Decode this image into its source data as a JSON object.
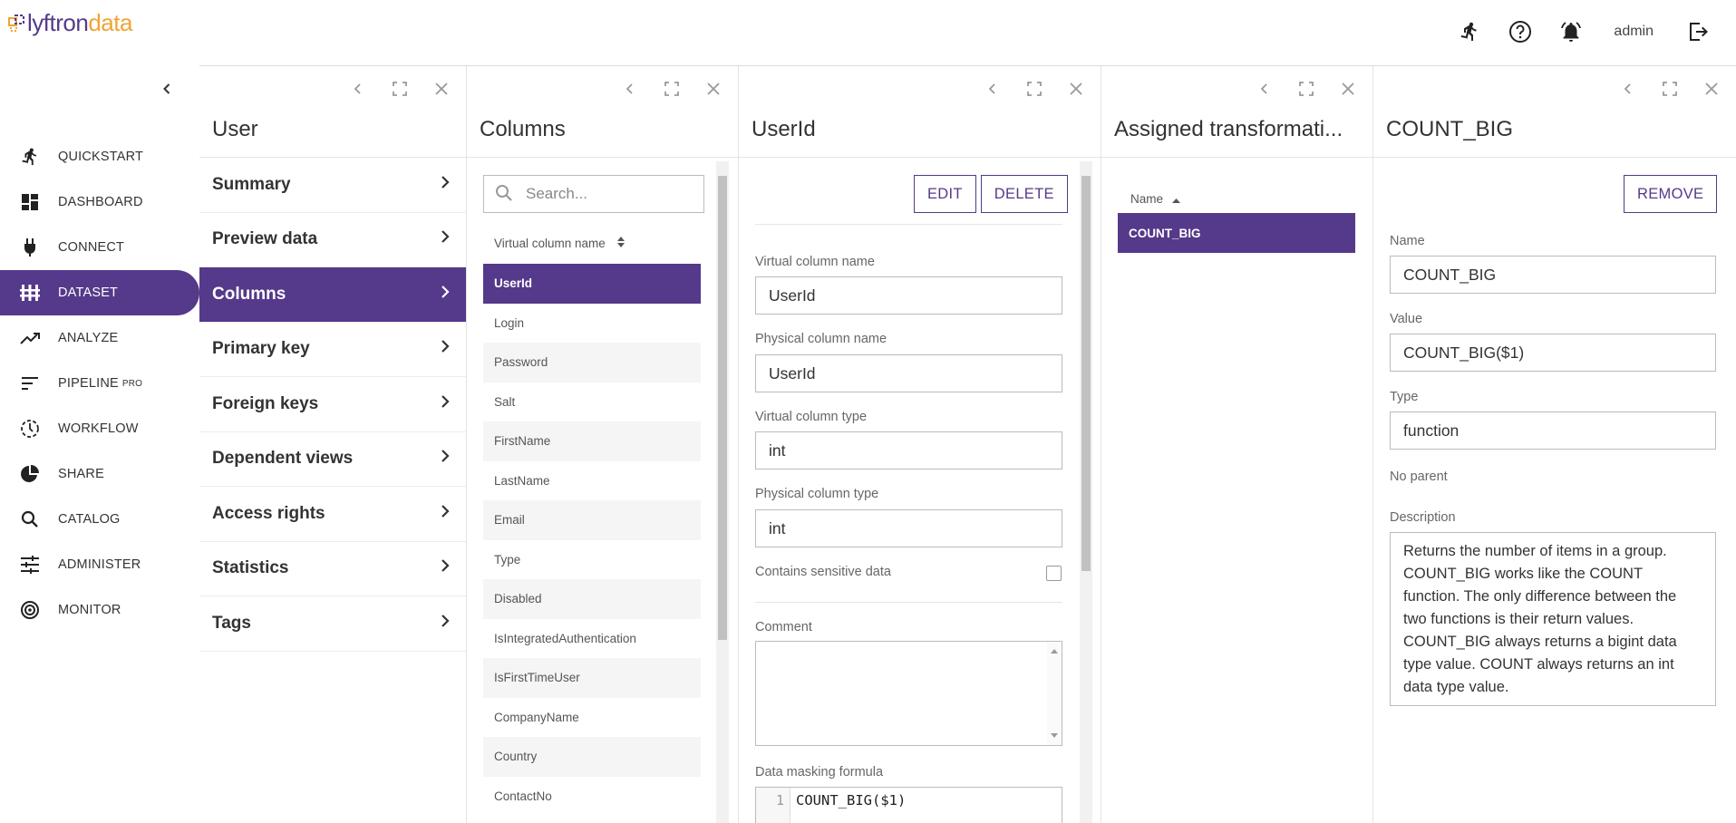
{
  "brand": {
    "logo_part1": "lyftron",
    "logo_part2": "data"
  },
  "header": {
    "user": "admin",
    "icons": [
      "quickstart-runner-icon",
      "help-icon",
      "notifications-bell-icon",
      "logout-icon"
    ]
  },
  "sidebar": {
    "items": [
      {
        "label": "QUICKSTART",
        "icon": "runner-icon"
      },
      {
        "label": "DASHBOARD",
        "icon": "dashboard-icon"
      },
      {
        "label": "CONNECT",
        "icon": "plug-icon"
      },
      {
        "label": "DATASET",
        "icon": "dataset-icon",
        "active": true
      },
      {
        "label": "ANALYZE",
        "icon": "trending-up-icon"
      },
      {
        "label": "PIPELINE",
        "badge": "PRO",
        "icon": "pipeline-icon"
      },
      {
        "label": "WORKFLOW",
        "icon": "workflow-icon"
      },
      {
        "label": "SHARE",
        "icon": "pie-chart-icon"
      },
      {
        "label": "CATALOG",
        "icon": "search-icon"
      },
      {
        "label": "ADMINISTER",
        "icon": "sliders-icon"
      },
      {
        "label": "MONITOR",
        "icon": "radar-icon"
      }
    ]
  },
  "panel_user": {
    "title": "User",
    "menu": [
      "Summary",
      "Preview data",
      "Columns",
      "Primary key",
      "Foreign keys",
      "Dependent views",
      "Access rights",
      "Statistics",
      "Tags"
    ]
  },
  "panel_columns": {
    "title": "Columns",
    "search_placeholder": "Search...",
    "column_header": "Virtual column name",
    "rows": [
      "UserId",
      "Login",
      "Password",
      "Salt",
      "FirstName",
      "LastName",
      "Email",
      "Type",
      "Disabled",
      "IsIntegratedAuthentication",
      "IsFirstTimeUser",
      "CompanyName",
      "Country",
      "ContactNo"
    ]
  },
  "panel_column_detail": {
    "title": "UserId",
    "edit_label": "EDIT",
    "delete_label": "DELETE",
    "virtual_name_label": "Virtual column name",
    "virtual_name": "UserId",
    "physical_name_label": "Physical column name",
    "physical_name": "UserId",
    "virtual_type_label": "Virtual column type",
    "virtual_type": "int",
    "physical_type_label": "Physical column type",
    "physical_type": "int",
    "sensitive_label": "Contains sensitive data",
    "comment_label": "Comment",
    "masking_label": "Data masking formula",
    "masking_line": "1",
    "masking_formula": "COUNT_BIG($1)"
  },
  "panel_transformations": {
    "title": "Assigned transformati...",
    "header": "Name",
    "rows": [
      "COUNT_BIG"
    ]
  },
  "panel_function": {
    "title": "COUNT_BIG",
    "remove_label": "REMOVE",
    "name_label": "Name",
    "name": "COUNT_BIG",
    "value_label": "Value",
    "value": "COUNT_BIG($1)",
    "type_label": "Type",
    "type": "function",
    "parent_text": "No parent",
    "description_label": "Description",
    "description": "Returns the number of items in a group. COUNT_BIG works like the COUNT function. The only difference between the two functions is their return values. COUNT_BIG always returns a bigint data type value. COUNT always returns an int data type value."
  },
  "colors": {
    "accent": "#55398a",
    "logo_orange": "#f0a432"
  }
}
